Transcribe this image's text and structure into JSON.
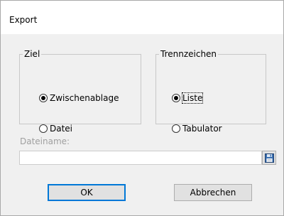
{
  "dialog": {
    "title": "Export"
  },
  "ziel": {
    "legend": "Ziel",
    "options": [
      {
        "label": "Zwischenablage",
        "checked": true
      },
      {
        "label": "Datei",
        "checked": false
      }
    ]
  },
  "trennzeichen": {
    "legend": "Trennzeichen",
    "options": [
      {
        "label": "Liste",
        "checked": true
      },
      {
        "label": "Tabulator",
        "checked": false
      }
    ]
  },
  "file": {
    "label": "Dateiname:",
    "value": "",
    "browse_icon": "floppy-disk-icon"
  },
  "buttons": {
    "ok": "OK",
    "cancel": "Abbrechen"
  },
  "colors": {
    "default_button_border": "#0078d7",
    "disabled_text": "#a0a0a0",
    "client_background": "#f0f0f0"
  }
}
